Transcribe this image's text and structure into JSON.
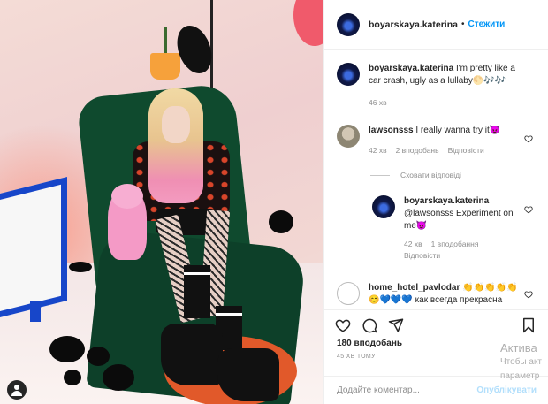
{
  "post": {
    "author": "boyarskaya.katerina",
    "follow_label": "Стежити",
    "separator": "•",
    "likes": "180 вподобань",
    "posted_ago": "45 ХВ ТОМУ"
  },
  "caption": {
    "username": "boyarskaya.katerina",
    "text": "I'm pretty like a car crash, ugly as a lullaby🌕🎶🎶",
    "time": "46 хв"
  },
  "comments": [
    {
      "username": "lawsonsss",
      "text": "I really wanna try it😈",
      "time": "42 хв",
      "likes": "2 вподобань",
      "reply": "Відповісти"
    },
    {
      "username": "home_hotel_pavlodar",
      "text": "👏👏👏👏👏😊💙💙💙 как всегда прекрасна",
      "time": "",
      "likes": "",
      "reply": ""
    }
  ],
  "hide_replies": "Сховати відповіді",
  "replies": [
    {
      "username": "boyarskaya.katerina",
      "text": "@lawsonsss Experiment on me😈",
      "time": "42 хв",
      "likes": "1 вподобання",
      "reply": "Відповісти"
    }
  ],
  "composer": {
    "placeholder": "Додайте коментар...",
    "post_label": "Опублікувати"
  },
  "watermark": {
    "line1": "Актива",
    "line2": "Чтобы акт",
    "line3": "параметр"
  },
  "icons": [
    "heart-icon",
    "comment-icon",
    "share-icon",
    "bookmark-icon",
    "user-tag-icon"
  ],
  "colors": {
    "link_blue": "#0095f6",
    "muted": "#8e8e8e",
    "text": "#262626",
    "post_disabled": "#b2dffc"
  }
}
